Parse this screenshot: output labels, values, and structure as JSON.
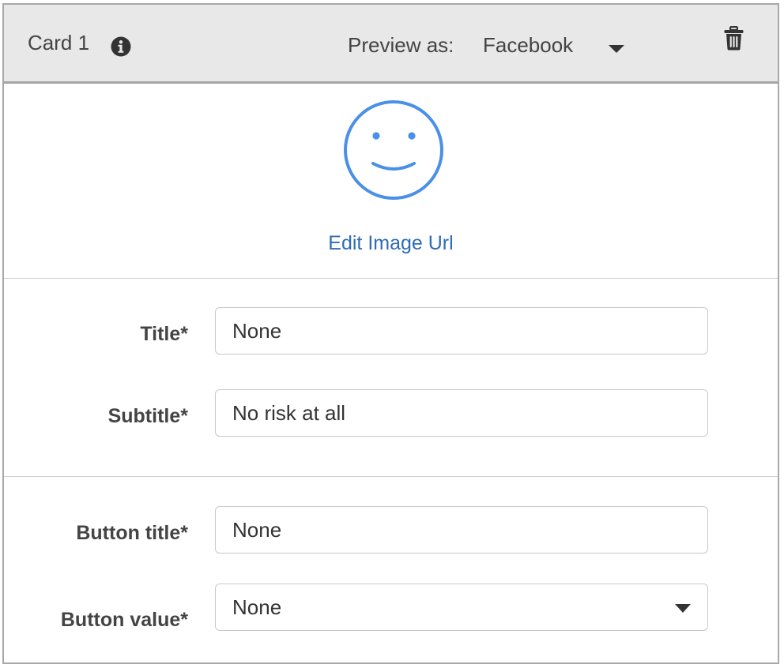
{
  "card": {
    "title": "Card 1",
    "info_icon": "info-circle-icon",
    "preview_label": "Preview as:",
    "preview_value": "Facebook",
    "delete_icon": "trash-icon"
  },
  "image": {
    "placeholder_icon": "smiley-face-icon",
    "edit_link": "Edit Image Url"
  },
  "fields": {
    "title": {
      "label": "Title*",
      "value": "None"
    },
    "subtitle": {
      "label": "Subtitle*",
      "value": "No risk at all"
    },
    "button_title": {
      "label": "Button title*",
      "value": "None"
    },
    "button_value": {
      "label": "Button value*",
      "value": "None"
    }
  },
  "colors": {
    "header_bg": "#e8e8e8",
    "link": "#2f6bb7",
    "icon_blue": "#4a90e8",
    "text": "#444444"
  }
}
